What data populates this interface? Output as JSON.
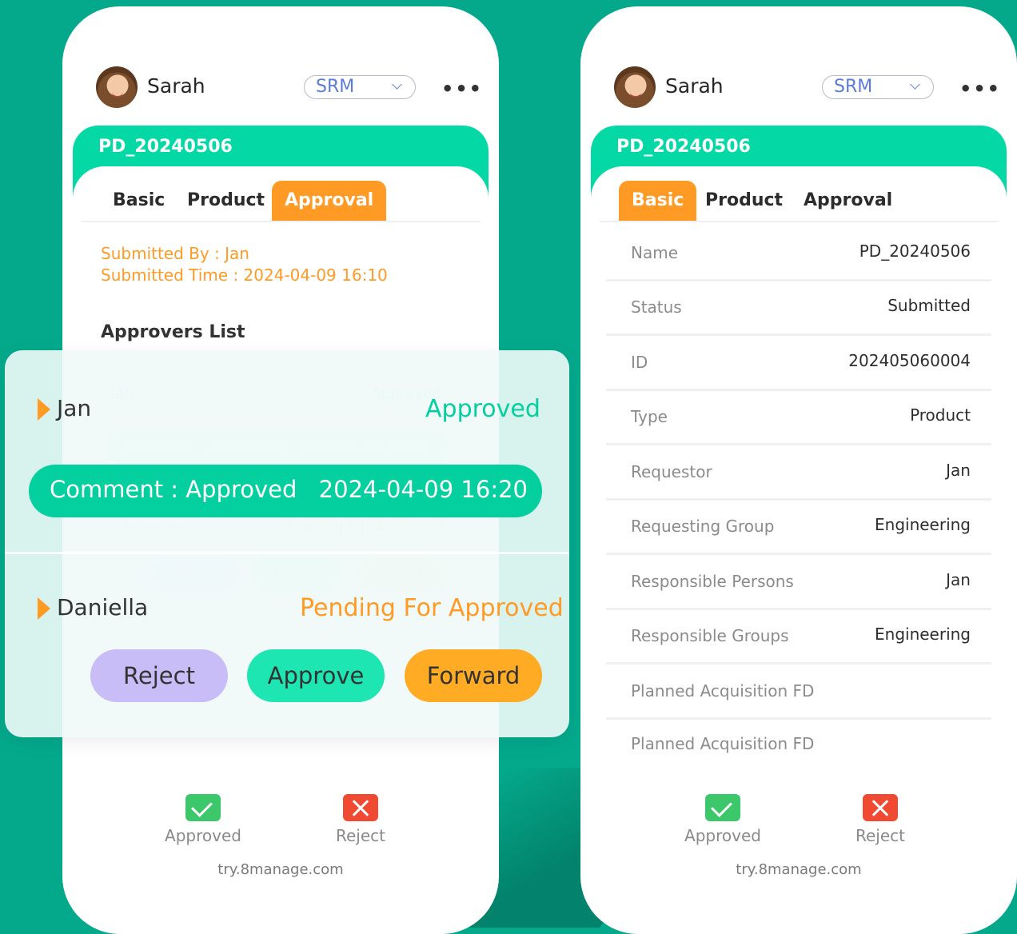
{
  "user": {
    "name": "Sarah"
  },
  "module_select": {
    "value": "SRM"
  },
  "project": {
    "title": "PD_20240506"
  },
  "tabs": [
    "Basic",
    "Product",
    "Approval"
  ],
  "left_phone": {
    "active_tab": "Approval",
    "submitted_by": "Submitted By : Jan",
    "submitted_time": "Submitted Time : 2024-04-09 16:10",
    "approvers_title": "Approvers List"
  },
  "right_phone": {
    "active_tab": "Basic",
    "fields": [
      {
        "label": "Name",
        "value": "PD_20240506"
      },
      {
        "label": "Status",
        "value": "Submitted"
      },
      {
        "label": "ID",
        "value": "202405060004"
      },
      {
        "label": "Type",
        "value": "Product"
      },
      {
        "label": "Requestor",
        "value": "Jan"
      },
      {
        "label": "Requesting Group",
        "value": "Engineering"
      },
      {
        "label": "Responsible Persons",
        "value": "Jan"
      },
      {
        "label": "Responsible Groups",
        "value": "Engineering"
      },
      {
        "label": "Planned Acquisition FD",
        "value": ""
      },
      {
        "label": "Planned Acquisition FD",
        "value": ""
      }
    ]
  },
  "approvers": [
    {
      "name": "Jan",
      "status": "Approved",
      "comment": "Comment : Approved",
      "comment_time": "2024-04-09  16:20"
    },
    {
      "name": "Daniella",
      "status": "Pending For Approved"
    }
  ],
  "approval_buttons": {
    "reject": "Reject",
    "approve": "Approve",
    "forward": "Forward"
  },
  "bottom_actions": {
    "approved": "Approved",
    "reject": "Reject"
  },
  "footer": {
    "site": "try.8manage.com"
  },
  "colors": {
    "brand_green": "#04d9a6",
    "accent_orange": "#ff9a24",
    "reject_purple": "#c8bdf7",
    "approve_teal": "#1de6b3",
    "forward_orange": "#ffab24"
  }
}
